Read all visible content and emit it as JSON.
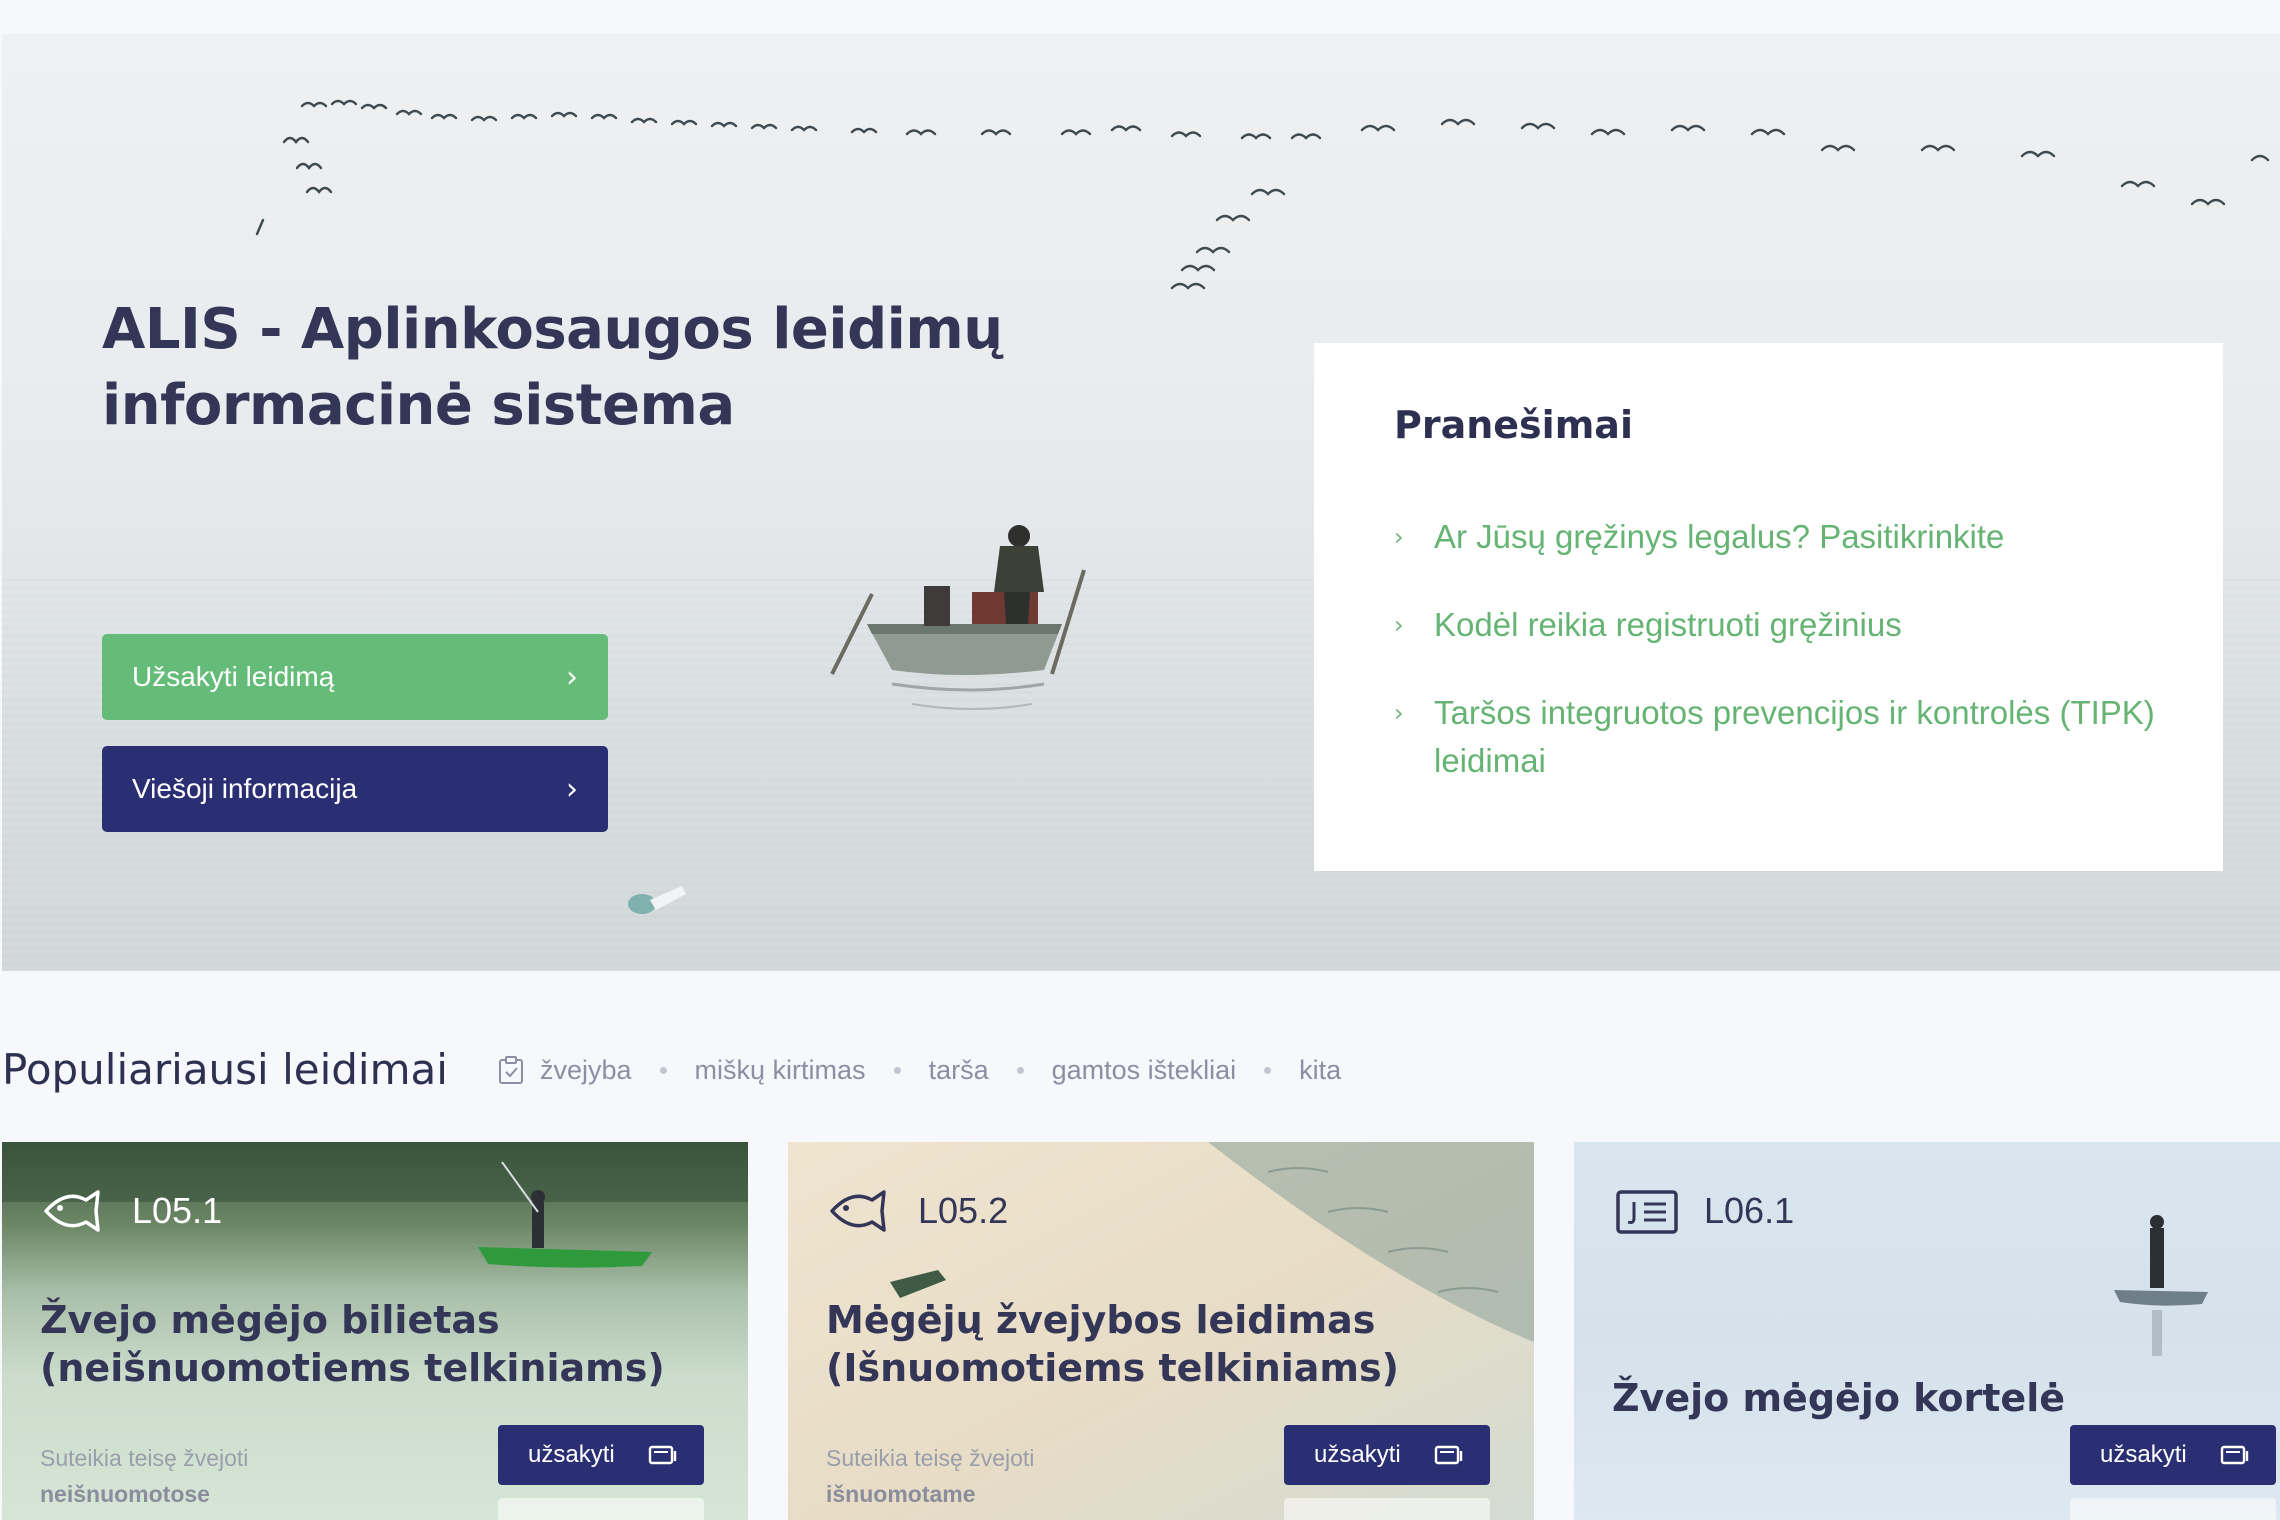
{
  "hero": {
    "title": "ALIS - Aplinkosaugos leidimų informacinė sistema",
    "buttons": [
      {
        "label": "Užsakyti leidimą"
      },
      {
        "label": "Viešoji informacija"
      }
    ]
  },
  "news": {
    "title": "Pranešimai",
    "items": [
      {
        "text": "Ar Jūsų gręžinys legalus? Pasitikrinkite"
      },
      {
        "text": "Kodėl reikia registruoti gręžinius"
      },
      {
        "text": "Taršos integruotos prevencijos ir kontrolės (TIPK) leidimai"
      }
    ]
  },
  "popular": {
    "title": "Populiariausi leidimai",
    "filters": [
      "žvejyba",
      "miškų kirtimas",
      "tarša",
      "gamtos ištekliai",
      "kita"
    ]
  },
  "cards": [
    {
      "code": "L05.1",
      "icon": "fish-icon",
      "title": "Žvejo mėgėjo bilietas (neišnuomotiems telkiniams)",
      "desc": "Suteikia teisę žvejoti",
      "desc_bold": "neišnuomotose",
      "order_label": "užsakyti"
    },
    {
      "code": "L05.2",
      "icon": "fish-icon",
      "title": "Mėgėjų žvejybos leidimas (Išnuomotiems telkiniams)",
      "desc": "Suteikia teisę žvejoti",
      "desc_bold": "išnuomotame",
      "order_label": "užsakyti"
    },
    {
      "code": "L06.1",
      "icon": "id-card-icon",
      "title": "Žvejo mėgėjo kortelė",
      "order_label": "užsakyti"
    }
  ],
  "colors": {
    "navy": "#2a2f73",
    "green": "#65bb78",
    "link_green": "#66b473",
    "heading": "#343657"
  }
}
